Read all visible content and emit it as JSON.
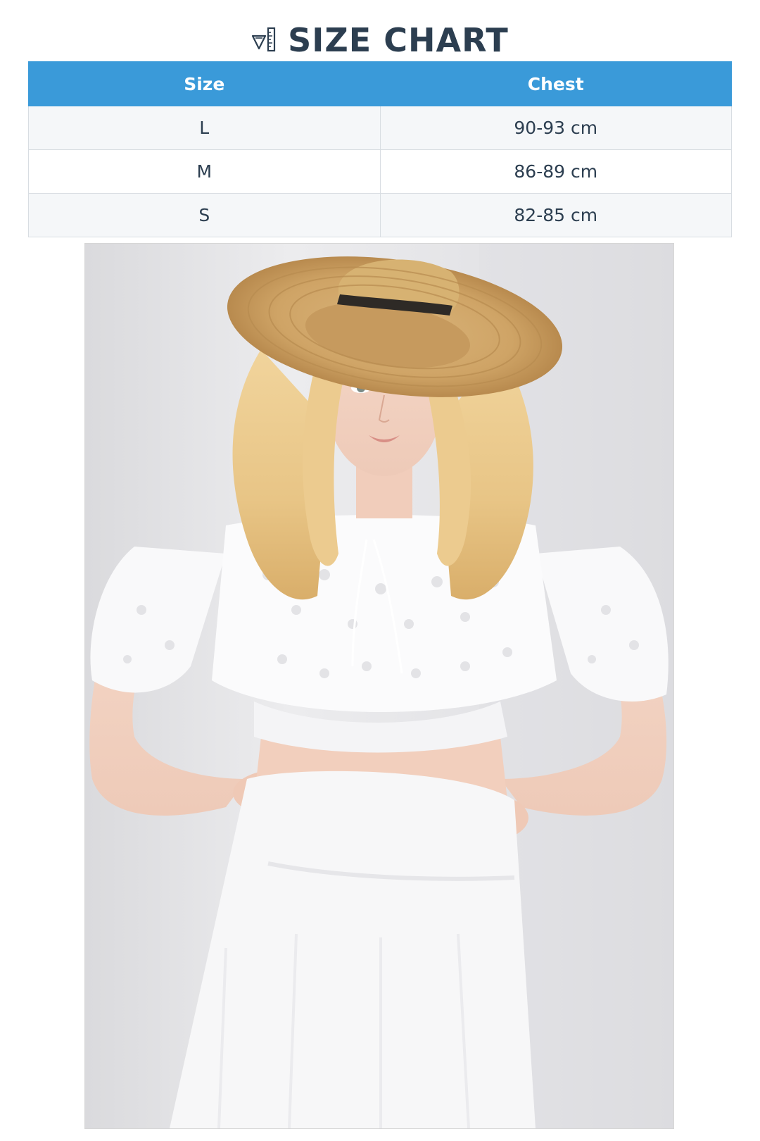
{
  "header": {
    "icon": "ruler-icon",
    "title": "SIZE CHART"
  },
  "table": {
    "columns": [
      "Size",
      "Chest"
    ],
    "rows": [
      {
        "size": "L",
        "chest": "90-93 cm"
      },
      {
        "size": "M",
        "chest": "86-89 cm"
      },
      {
        "size": "S",
        "chest": "82-85 cm"
      }
    ]
  },
  "colors": {
    "header_bg": "#3a9ad9",
    "title_text": "#2c3e50",
    "row_stripe": "#f5f7f9"
  },
  "photo": {
    "subject": "model-photo"
  }
}
